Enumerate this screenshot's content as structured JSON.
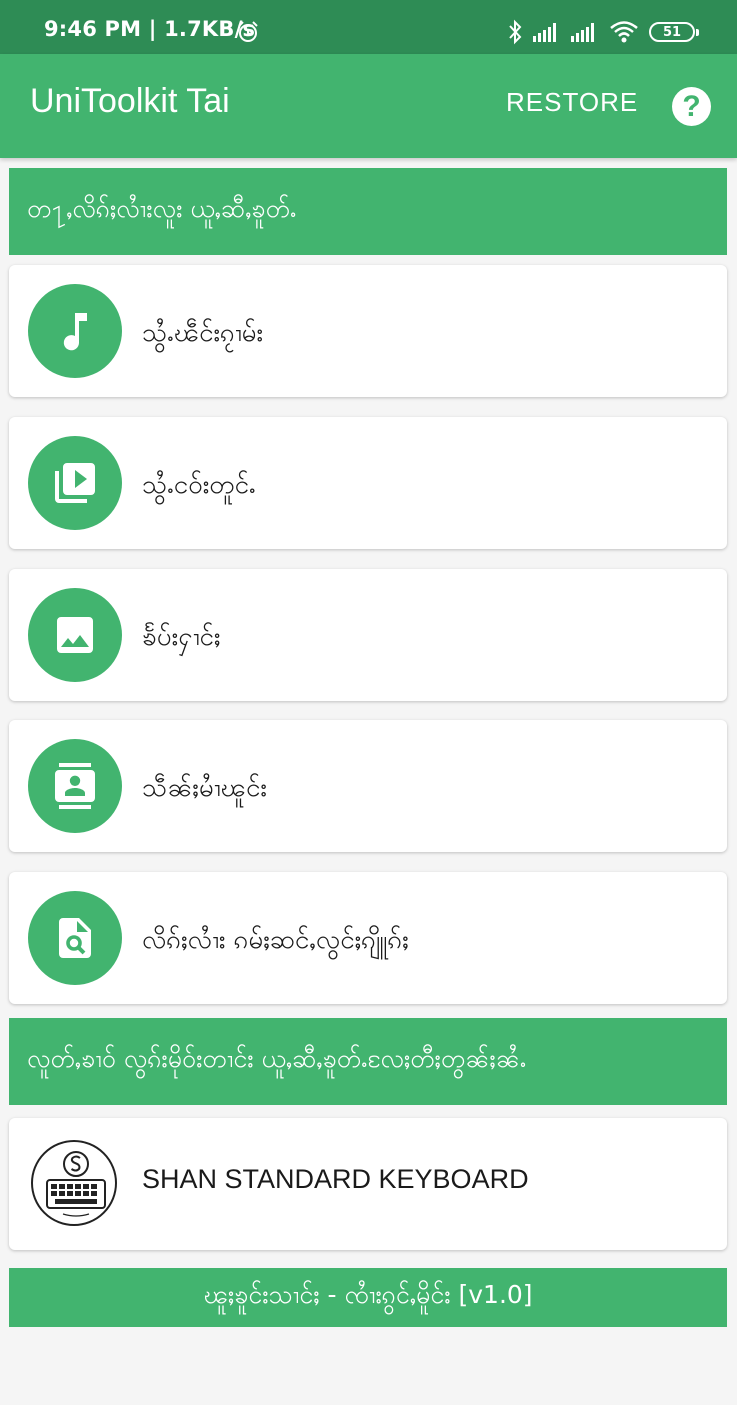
{
  "status_bar": {
    "time": "9:46 PM | 1.7KB/s",
    "battery": "51"
  },
  "app_bar": {
    "title": "UniToolkit Tai",
    "restore_label": "RESTORE",
    "help_label": "?"
  },
  "section_1": {
    "header": "တ႑ႇလိၵ်ႈလၢႆးလူး ယူႇဆီႇၶူတ်ႉ",
    "items": [
      {
        "label": "သွႆႉၽဵင်းၵႂၢမ်း",
        "icon": "music-note-icon"
      },
      {
        "label": "သွႆႉငဝ်းတူင်ႉ",
        "icon": "video-library-icon"
      },
      {
        "label": "ၶႅပ်းႁၢင်ႈ",
        "icon": "image-icon"
      },
      {
        "label": "သဵၼ်ႈမၢႆၽူင်း",
        "icon": "contact-icon"
      },
      {
        "label": "လိၵ်ႈလၢႆး ၵမ်ႈဆင်ႇလွင်ႈၵျိူၵ်ႈ",
        "icon": "file-search-icon"
      }
    ]
  },
  "section_2": {
    "header": "လူတ်ႇၶၢဝ် လွၵ်းမိုဝ်းတၢင်း ယူႇဆီႇၶူတ်ႉလႄႈတီႈတွၼ်ႈၼႆႉ",
    "items": [
      {
        "label": "SHAN STANDARD KEYBOARD",
        "icon": "shan-keyboard-logo"
      }
    ]
  },
  "footer": {
    "text": "ၽူႈၶူင်းသၢင်ႈ - ၸၢႆးၵွင်ႇမိူင်း [v1.0]"
  },
  "colors": {
    "primary": "#42b46f",
    "status_bar": "#2e8c55",
    "background": "#f5f5f5"
  }
}
